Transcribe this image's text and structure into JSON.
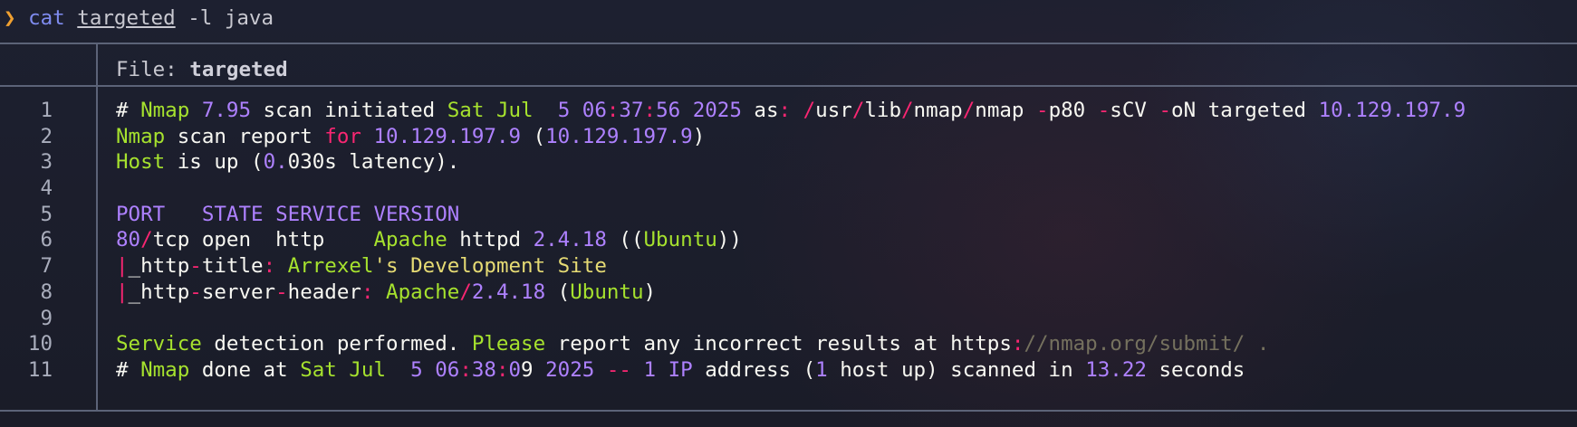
{
  "prompt": {
    "symbol": "❯",
    "command": "cat",
    "file_arg": "targeted",
    "flags": "-l java"
  },
  "header": {
    "label": "File: ",
    "filename": "targeted"
  },
  "lines": [
    {
      "num": "1",
      "segments": [
        [
          "w",
          "# "
        ],
        [
          "g",
          "Nmap"
        ],
        [
          "w",
          " "
        ],
        [
          "p",
          "7.95"
        ],
        [
          "w",
          " scan initiated "
        ],
        [
          "g",
          "Sat Jul"
        ],
        [
          "w",
          "  "
        ],
        [
          "p",
          "5"
        ],
        [
          "w",
          " "
        ],
        [
          "p",
          "06"
        ],
        [
          "r",
          ":"
        ],
        [
          "p",
          "37"
        ],
        [
          "r",
          ":"
        ],
        [
          "p",
          "56"
        ],
        [
          "w",
          " "
        ],
        [
          "p",
          "2025"
        ],
        [
          "w",
          " as"
        ],
        [
          "r",
          ":"
        ],
        [
          "w",
          " "
        ],
        [
          "r",
          "/"
        ],
        [
          "w",
          "usr"
        ],
        [
          "r",
          "/"
        ],
        [
          "w",
          "lib"
        ],
        [
          "r",
          "/"
        ],
        [
          "w",
          "nmap"
        ],
        [
          "r",
          "/"
        ],
        [
          "w",
          "nmap "
        ],
        [
          "r",
          "-"
        ],
        [
          "w",
          "p80 "
        ],
        [
          "r",
          "-"
        ],
        [
          "w",
          "sCV "
        ],
        [
          "r",
          "-"
        ],
        [
          "w",
          "oN targeted "
        ],
        [
          "p",
          "10.129.197.9"
        ]
      ]
    },
    {
      "num": "2",
      "segments": [
        [
          "g",
          "Nmap"
        ],
        [
          "w",
          " scan report "
        ],
        [
          "r",
          "for"
        ],
        [
          "w",
          " "
        ],
        [
          "p",
          "10.129.197.9"
        ],
        [
          "w",
          " ("
        ],
        [
          "p",
          "10.129.197.9"
        ],
        [
          "w",
          ")"
        ]
      ]
    },
    {
      "num": "3",
      "segments": [
        [
          "g",
          "Host"
        ],
        [
          "w",
          " is up ("
        ],
        [
          "p",
          "0."
        ],
        [
          "w",
          "030s latency)."
        ]
      ]
    },
    {
      "num": "4",
      "segments": []
    },
    {
      "num": "5",
      "segments": [
        [
          "p",
          "PORT   STATE SERVICE VERSION"
        ]
      ]
    },
    {
      "num": "6",
      "segments": [
        [
          "p",
          "80"
        ],
        [
          "r",
          "/"
        ],
        [
          "w",
          "tcp open  http    "
        ],
        [
          "g",
          "Apache"
        ],
        [
          "w",
          " httpd "
        ],
        [
          "p",
          "2.4.18"
        ],
        [
          "w",
          " (("
        ],
        [
          "g",
          "Ubuntu"
        ],
        [
          "w",
          "))"
        ]
      ]
    },
    {
      "num": "7",
      "segments": [
        [
          "r",
          "|"
        ],
        [
          "w",
          "_http"
        ],
        [
          "r",
          "-"
        ],
        [
          "w",
          "title"
        ],
        [
          "r",
          ":"
        ],
        [
          "w",
          " "
        ],
        [
          "g",
          "Arrexel"
        ],
        [
          "y",
          "'s Development Site"
        ]
      ]
    },
    {
      "num": "8",
      "segments": [
        [
          "r",
          "|"
        ],
        [
          "w",
          "_http"
        ],
        [
          "r",
          "-"
        ],
        [
          "w",
          "server"
        ],
        [
          "r",
          "-"
        ],
        [
          "w",
          "header"
        ],
        [
          "r",
          ":"
        ],
        [
          "w",
          " "
        ],
        [
          "g",
          "Apache"
        ],
        [
          "r",
          "/"
        ],
        [
          "p",
          "2.4.18"
        ],
        [
          "w",
          " ("
        ],
        [
          "g",
          "Ubuntu"
        ],
        [
          "w",
          ")"
        ]
      ]
    },
    {
      "num": "9",
      "segments": []
    },
    {
      "num": "10",
      "segments": [
        [
          "g",
          "Service"
        ],
        [
          "w",
          " detection performed. "
        ],
        [
          "g",
          "Please"
        ],
        [
          "w",
          " report any incorrect results at https"
        ],
        [
          "r",
          ":"
        ],
        [
          "d",
          "//nmap.org/submit/ ."
        ]
      ]
    },
    {
      "num": "11",
      "segments": [
        [
          "w",
          "# "
        ],
        [
          "g",
          "Nmap"
        ],
        [
          "w",
          " done at "
        ],
        [
          "g",
          "Sat Jul"
        ],
        [
          "w",
          "  "
        ],
        [
          "p",
          "5"
        ],
        [
          "w",
          " "
        ],
        [
          "p",
          "06"
        ],
        [
          "r",
          ":"
        ],
        [
          "p",
          "38"
        ],
        [
          "r",
          ":"
        ],
        [
          "p",
          "0"
        ],
        [
          "w",
          "9 "
        ],
        [
          "p",
          "2025"
        ],
        [
          "w",
          " "
        ],
        [
          "r",
          "--"
        ],
        [
          "w",
          " "
        ],
        [
          "p",
          "1"
        ],
        [
          "w",
          " "
        ],
        [
          "p",
          "IP"
        ],
        [
          "w",
          " address ("
        ],
        [
          "p",
          "1"
        ],
        [
          "w",
          " host up) scanned in "
        ],
        [
          "p",
          "13.22"
        ],
        [
          "w",
          " seconds"
        ]
      ]
    }
  ]
}
